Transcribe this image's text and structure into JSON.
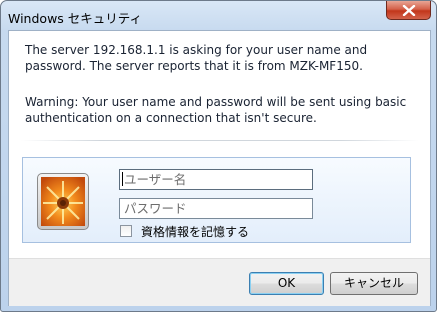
{
  "window": {
    "title": "Windows セキュリティ"
  },
  "message": {
    "line_server": "The server 192.168.1.1 is asking for your user name and password. The server reports that it is from MZK-MF150.",
    "line_warning": "Warning: Your user name and password will be sent using basic authentication on a connection that isn't secure."
  },
  "credentials": {
    "username_placeholder": "ユーザー名",
    "username_value": "",
    "password_placeholder": "パスワード",
    "password_value": "",
    "remember_label": "資格情報を記憶する",
    "remember_checked": false
  },
  "buttons": {
    "ok_label": "OK",
    "cancel_label": "キャンセル"
  },
  "colors": {
    "frame": "#c7daef",
    "close_button": "#c2361b",
    "panel_border": "#a6c0e0"
  }
}
